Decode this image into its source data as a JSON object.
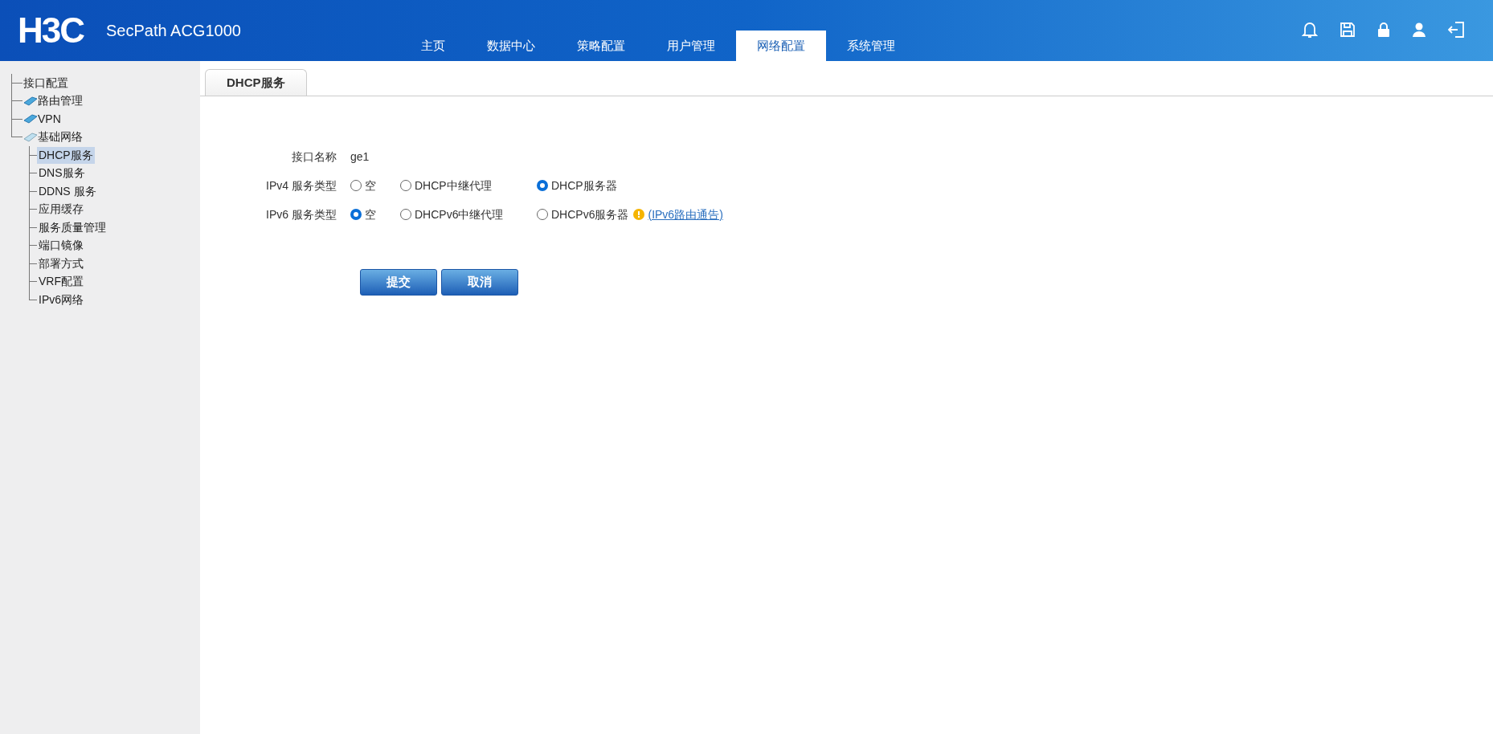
{
  "header": {
    "logo": "H3C",
    "product": "SecPath ACG1000",
    "nav": [
      {
        "label": "主页",
        "selected": false
      },
      {
        "label": "数据中心",
        "selected": false
      },
      {
        "label": "策略配置",
        "selected": false
      },
      {
        "label": "用户管理",
        "selected": false
      },
      {
        "label": "网络配置",
        "selected": true
      },
      {
        "label": "系统管理",
        "selected": false
      }
    ]
  },
  "sidebar": {
    "items": [
      {
        "label": "接口配置",
        "kind": "leaf"
      },
      {
        "label": "路由管理",
        "kind": "folder",
        "expanded": false
      },
      {
        "label": "VPN",
        "kind": "folder",
        "expanded": false
      },
      {
        "label": "基础网络",
        "kind": "folder",
        "expanded": true,
        "children": [
          {
            "label": "DHCP服务",
            "selected": true
          },
          {
            "label": "DNS服务",
            "selected": false
          },
          {
            "label": "DDNS 服务",
            "selected": false
          },
          {
            "label": "应用缓存",
            "selected": false
          },
          {
            "label": "服务质量管理",
            "selected": false
          },
          {
            "label": "端口镜像",
            "selected": false
          },
          {
            "label": "部署方式",
            "selected": false
          },
          {
            "label": "VRF配置",
            "selected": false
          },
          {
            "label": "IPv6网络",
            "selected": false
          }
        ]
      }
    ]
  },
  "tabs": [
    {
      "label": "DHCP服务",
      "selected": true
    }
  ],
  "form": {
    "interface_label": "接口名称",
    "interface_value": "ge1",
    "rows": [
      {
        "label": "IPv4 服务类型",
        "options": [
          {
            "label": "空",
            "selected": false
          },
          {
            "label": "DHCP中继代理",
            "selected": false
          },
          {
            "label": "DHCP服务器",
            "selected": true
          }
        ]
      },
      {
        "label": "IPv6 服务类型",
        "options": [
          {
            "label": "空",
            "selected": true
          },
          {
            "label": "DHCPv6中继代理",
            "selected": false
          },
          {
            "label": "DHCPv6服务器",
            "selected": false
          }
        ],
        "warning_link": "(IPv6路由通告)"
      }
    ],
    "buttons": [
      "提交",
      "取消"
    ]
  }
}
